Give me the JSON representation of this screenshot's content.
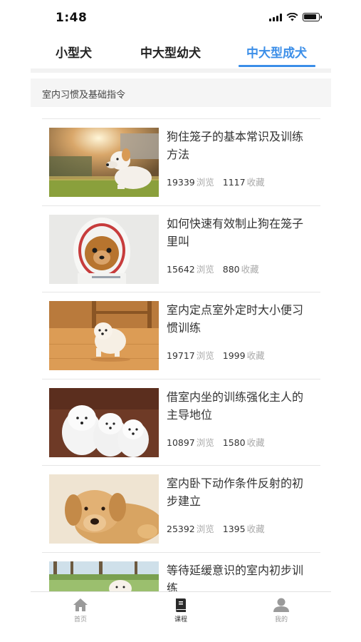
{
  "status_bar": {
    "time": "1:48"
  },
  "tabs": [
    {
      "label": "小型犬",
      "active": false
    },
    {
      "label": "中大型幼犬",
      "active": false
    },
    {
      "label": "中大型成犬",
      "active": true
    }
  ],
  "accent_color": "#3b8ee8",
  "section": {
    "title": "室内习惯及基础指令"
  },
  "stats_labels": {
    "views": "浏览",
    "favorites": "收藏"
  },
  "articles": [
    {
      "title": "狗住笼子的基本常识及训练方法",
      "views": "19339",
      "favorites": "1117",
      "image": "white-dog-on-grass"
    },
    {
      "title": "如何快速有效制止狗在笼子里叫",
      "views": "15642",
      "favorites": "880",
      "image": "puppy-in-hoodie"
    },
    {
      "title": "室内定点室外定时大小便习惯训练",
      "views": "19717",
      "favorites": "1999",
      "image": "puppy-on-wood-floor"
    },
    {
      "title": "借室内坐的训练强化主人的主导地位",
      "views": "10897",
      "favorites": "1580",
      "image": "three-white-puppies"
    },
    {
      "title": "室内卧下动作条件反射的初步建立",
      "views": "25392",
      "favorites": "1395",
      "image": "golden-retriever-lying"
    },
    {
      "title": "等待延缓意识的室内初步训练",
      "views": "",
      "favorites": "",
      "image": "dog-in-park"
    }
  ],
  "bottom_nav": [
    {
      "label": "首页",
      "icon": "home-icon",
      "active": false
    },
    {
      "label": "课程",
      "icon": "book-icon",
      "active": true
    },
    {
      "label": "我的",
      "icon": "user-icon",
      "active": false
    }
  ]
}
